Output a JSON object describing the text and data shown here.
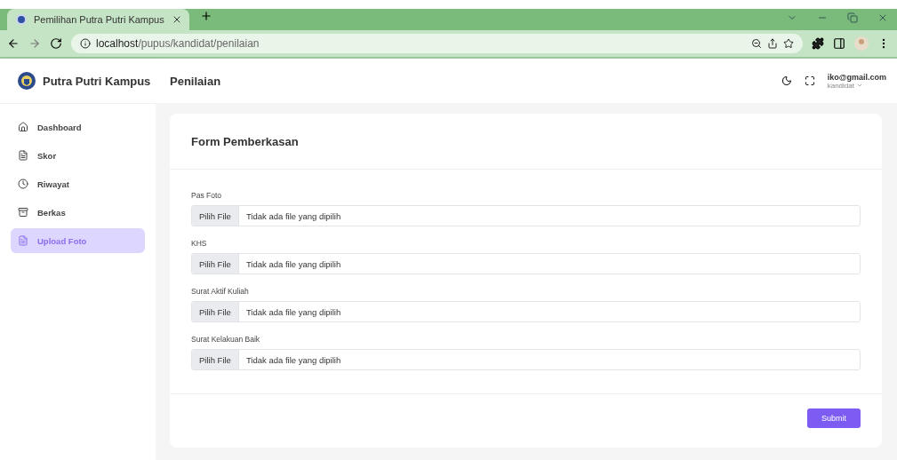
{
  "browser": {
    "tab": {
      "title": "Pemilihan Putra Putri Kampus",
      "selected": true
    },
    "address": {
      "host": "localhost",
      "path": "/pupus/kandidat/penilaian"
    }
  },
  "brand": {
    "name": "Putra Putri Kampus"
  },
  "header": {
    "title": "Penilaian",
    "user": {
      "email": "iko@gmail.com",
      "role": "kandidat"
    }
  },
  "sidebar": {
    "items": [
      {
        "label": "Dashboard",
        "selected": false
      },
      {
        "label": "Skor",
        "selected": false
      },
      {
        "label": "Riwayat",
        "selected": false
      },
      {
        "label": "Berkas",
        "selected": false
      },
      {
        "label": "Upload Foto",
        "selected": true
      }
    ]
  },
  "form": {
    "title": "Form Pemberkasan",
    "fields": [
      {
        "label": "Pas Foto",
        "button": "Pilih File",
        "status": "Tidak ada file yang dipilih"
      },
      {
        "label": "KHS",
        "button": "Pilih File",
        "status": "Tidak ada file yang dipilih"
      },
      {
        "label": "Surat Aktif Kuliah",
        "button": "Pilih File",
        "status": "Tidak ada file yang dipilih"
      },
      {
        "label": "Surat Kelakuan Baik",
        "button": "Pilih File",
        "status": "Tidak ada file yang dipilih"
      }
    ],
    "submit": "Submit"
  }
}
